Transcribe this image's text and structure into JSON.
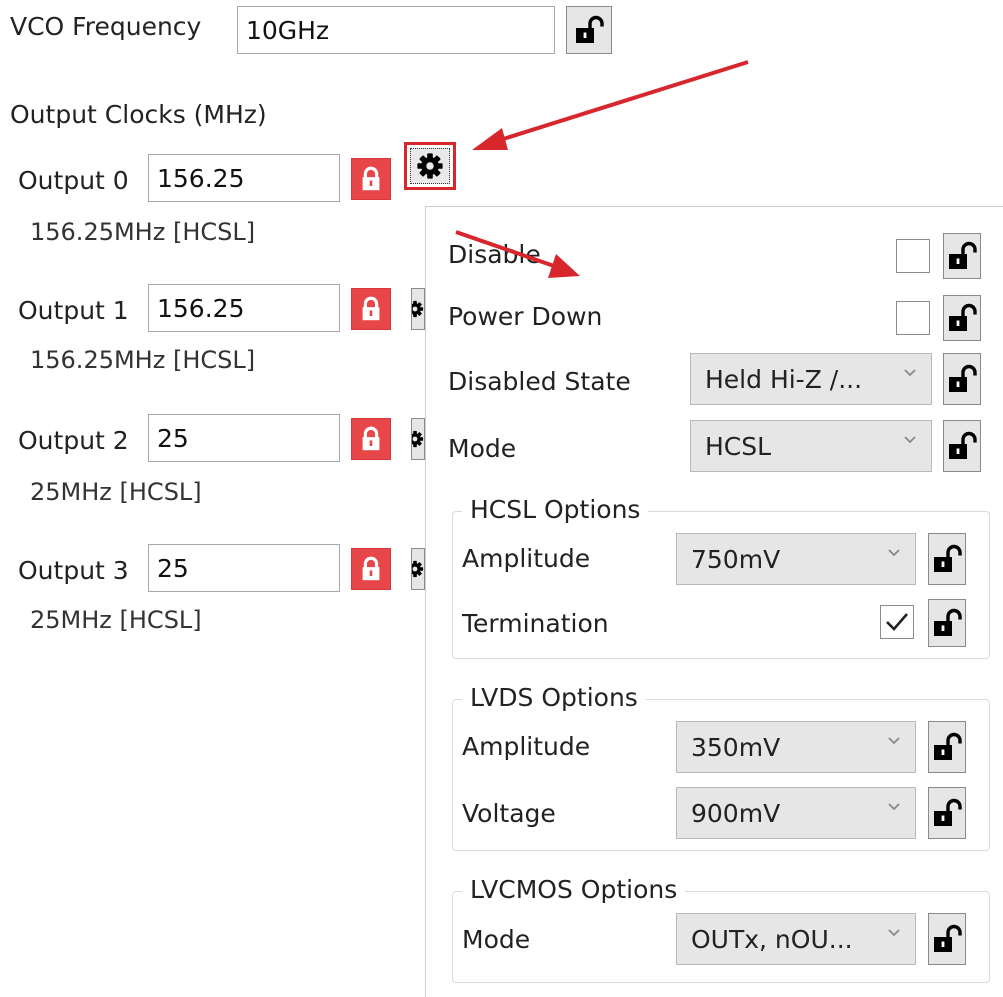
{
  "vco": {
    "label": "VCO Frequency",
    "value": "10GHz"
  },
  "output_clocks": {
    "heading": "Output Clocks (MHz)",
    "outputs": [
      {
        "label": "Output 0",
        "value": "156.25",
        "summary": "156.25MHz [HCSL]"
      },
      {
        "label": "Output 1",
        "value": "156.25",
        "summary": "156.25MHz [HCSL]"
      },
      {
        "label": "Output 2",
        "value": "25",
        "summary": "25MHz [HCSL]"
      },
      {
        "label": "Output 3",
        "value": "25",
        "summary": "25MHz [HCSL]"
      }
    ]
  },
  "settings_panel": {
    "disable": {
      "label": "Disable",
      "checked": false
    },
    "power_down": {
      "label": "Power Down",
      "checked": false
    },
    "disabled_state": {
      "label": "Disabled State",
      "value": "Held Hi-Z /..."
    },
    "mode": {
      "label": "Mode",
      "value": "HCSL"
    },
    "hcsl": {
      "title": "HCSL Options",
      "amplitude_label": "Amplitude",
      "amplitude_value": "750mV",
      "termination_label": "Termination",
      "termination_checked": true
    },
    "lvds": {
      "title": "LVDS Options",
      "amplitude_label": "Amplitude",
      "amplitude_value": "350mV",
      "voltage_label": "Voltage",
      "voltage_value": "900mV"
    },
    "lvcmos": {
      "title": "LVCMOS Options",
      "mode_label": "Mode",
      "mode_value": "OUTx, nOU..."
    }
  },
  "colors": {
    "annotation_red": "#d7262c",
    "locked_red": "#e8474a",
    "dropdown_gray": "#e6e6e6"
  }
}
